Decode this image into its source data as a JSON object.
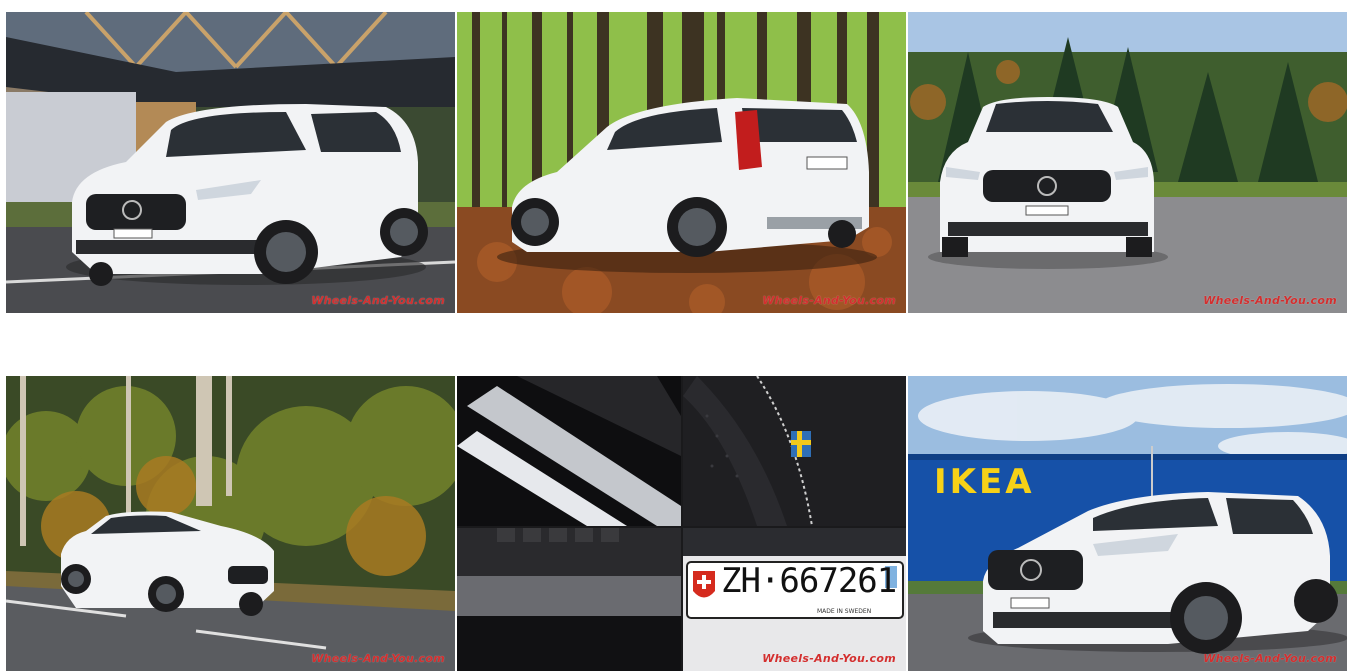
{
  "gallery": {
    "photos": [
      {
        "subject": "white-suv-front-three-quarter-modern-building",
        "watermark": "Wheels-And-You.com"
      },
      {
        "subject": "white-suv-rear-three-quarter-forest",
        "watermark": "Wheels-And-You.com"
      },
      {
        "subject": "white-suv-front-view-parking-lot",
        "watermark": "Wheels-And-You.com"
      },
      {
        "subject": "white-suv-driving-road-autumn-trees",
        "watermark": "Wheels-And-You.com"
      },
      {
        "subject": "interior-detail-collage",
        "watermark": "Wheels-And-You.com",
        "plate_text": "ZH·667261",
        "plate_small": "MADE IN SWEDEN"
      },
      {
        "subject": "white-suv-in-front-of-store",
        "watermark": "Wheels-And-You.com",
        "sign_text": "IKEA"
      }
    ]
  },
  "colors": {
    "car_white": "#f2f3f5",
    "watermark_red": "#d32f2f",
    "ikea_blue": "#1651a8",
    "ikea_yellow": "#f7d117"
  }
}
